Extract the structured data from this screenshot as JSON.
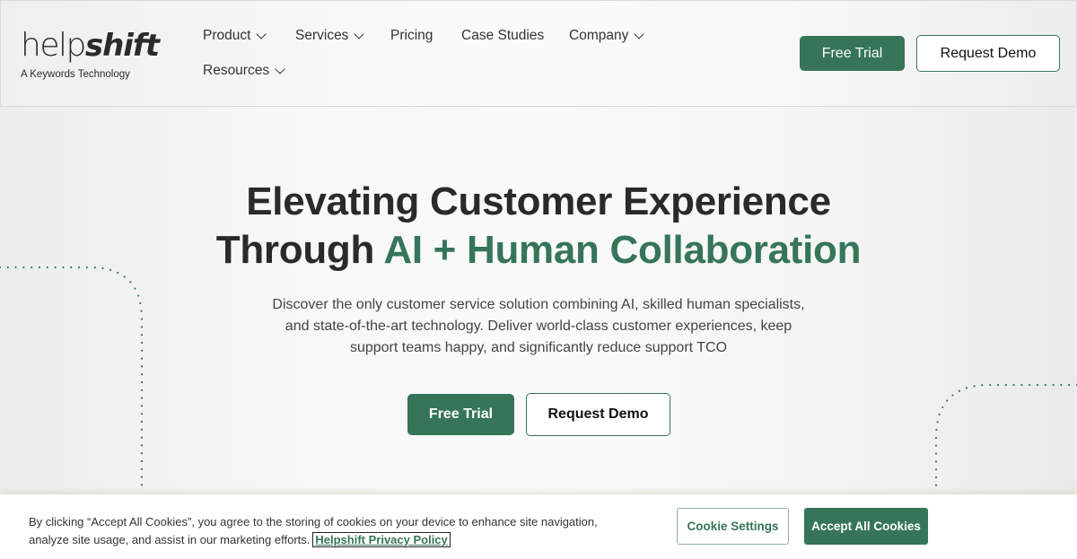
{
  "brand": {
    "logo_light": "help",
    "logo_bold": "shift",
    "tagline": "A Keywords Technology",
    "accent_color": "#367559"
  },
  "nav": {
    "items": [
      {
        "label": "Product",
        "has_dropdown": true
      },
      {
        "label": "Services",
        "has_dropdown": true
      },
      {
        "label": "Pricing",
        "has_dropdown": false
      },
      {
        "label": "Case Studies",
        "has_dropdown": false
      },
      {
        "label": "Company",
        "has_dropdown": true
      },
      {
        "label": "Resources",
        "has_dropdown": true
      }
    ],
    "free_trial": "Free Trial",
    "request_demo": "Request Demo"
  },
  "hero": {
    "title_line1": "Elevating Customer Experience",
    "title_line2_plain": "Through ",
    "title_line2_accent": "AI + Human Collaboration",
    "subtitle_line1": "Discover the only customer service solution combining AI, skilled human specialists,",
    "subtitle_line2": "and state-of-the-art technology. Deliver world-class customer experiences, keep",
    "subtitle_line3": "support teams happy, and significantly reduce support TCO",
    "free_trial": "Free Trial",
    "request_demo": "Request Demo"
  },
  "cookie_banner": {
    "text_line1": "By clicking “Accept All Cookies”, you agree to the storing of cookies on your device to enhance site navigation,",
    "text_line2": "analyze site usage, and assist in our marketing efforts.",
    "policy_link": "Helpshift Privacy Policy",
    "settings_button": "Cookie Settings",
    "accept_button": "Accept All Cookies"
  }
}
